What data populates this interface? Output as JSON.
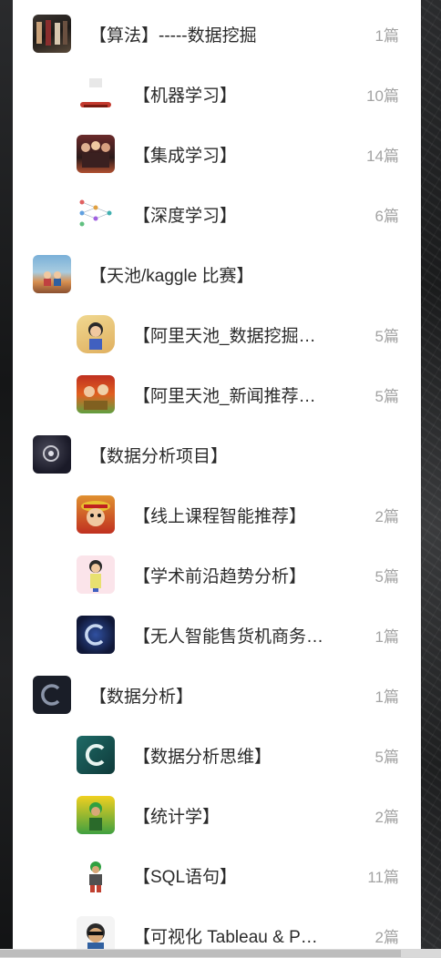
{
  "categories": [
    {
      "label": "【算法】-----数据挖掘",
      "count": "1篇",
      "level": "top",
      "thumb": "algo"
    },
    {
      "label": "【机器学习】",
      "count": "10篇",
      "level": "sub",
      "thumb": "ml"
    },
    {
      "label": "【集成学习】",
      "count": "14篇",
      "level": "sub",
      "thumb": "ensemble"
    },
    {
      "label": "【深度学习】",
      "count": "6篇",
      "level": "sub",
      "thumb": "dl"
    },
    {
      "label": "【天池/kaggle 比赛】",
      "count": "",
      "level": "top",
      "thumb": "tianchi"
    },
    {
      "label": "【阿里天池_数据挖掘…",
      "count": "5篇",
      "level": "sub",
      "thumb": "ali1"
    },
    {
      "label": "【阿里天池_新闻推荐…",
      "count": "5篇",
      "level": "sub",
      "thumb": "ali2"
    },
    {
      "label": "【数据分析项目】",
      "count": "",
      "level": "top",
      "thumb": "project"
    },
    {
      "label": "【线上课程智能推荐】",
      "count": "2篇",
      "level": "sub",
      "thumb": "course"
    },
    {
      "label": "【学术前沿趋势分析】",
      "count": "5篇",
      "level": "sub",
      "thumb": "academic"
    },
    {
      "label": "【无人智能售货机商务…",
      "count": "1篇",
      "level": "sub",
      "thumb": "vending"
    },
    {
      "label": "【数据分析】",
      "count": "1篇",
      "level": "top",
      "thumb": "analysis"
    },
    {
      "label": "【数据分析思维】",
      "count": "5篇",
      "level": "sub",
      "thumb": "thinking"
    },
    {
      "label": "【统计学】",
      "count": "2篇",
      "level": "sub",
      "thumb": "stats"
    },
    {
      "label": "【SQL语句】",
      "count": "11篇",
      "level": "sub",
      "thumb": "sql"
    },
    {
      "label": "【可视化 Tableau & P…",
      "count": "2篇",
      "level": "sub",
      "thumb": "viz"
    }
  ],
  "colors": {
    "label": "#2b2b2b",
    "count": "#a3a3a3",
    "panel": "#ffffff",
    "background": "#1c1d1f"
  }
}
